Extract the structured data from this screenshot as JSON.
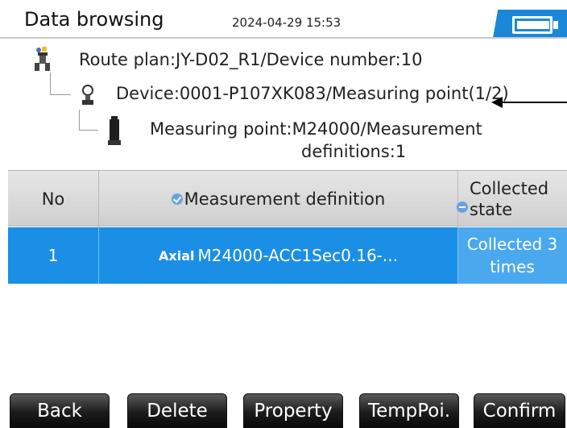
{
  "header": {
    "title": "Data browsing",
    "datetime": "2024-04-29 15:53",
    "battery_icon": "battery-icon"
  },
  "tree": {
    "route": {
      "icon": "route-plan-icon",
      "label": "Route plan:JY-D02_R1/Device number:10"
    },
    "device": {
      "icon": "device-icon",
      "label": "Device:0001-P107XK083/Measuring point(1/2)"
    },
    "point": {
      "icon": "measuring-point-icon",
      "label_line1": "Measuring point:M24000/Measurement",
      "label_line2": "definitions:1"
    }
  },
  "table": {
    "columns": {
      "no": "No",
      "definition": "Measurement definition",
      "state_line1": "Collected",
      "state_line2": "state"
    },
    "rows": [
      {
        "no": "1",
        "prefix": "Axial",
        "definition": "M24000-ACC1Sec0.16-...",
        "state_line1": "Collected 3",
        "state_line2": "times",
        "selected": true
      }
    ]
  },
  "buttons": {
    "back": "Back",
    "delete": "Delete",
    "property": "Property",
    "temppoi": "TempPoi.",
    "confirm": "Confirm"
  },
  "colors": {
    "selection": "#1b8fe6",
    "accent": "#1a88d6"
  }
}
